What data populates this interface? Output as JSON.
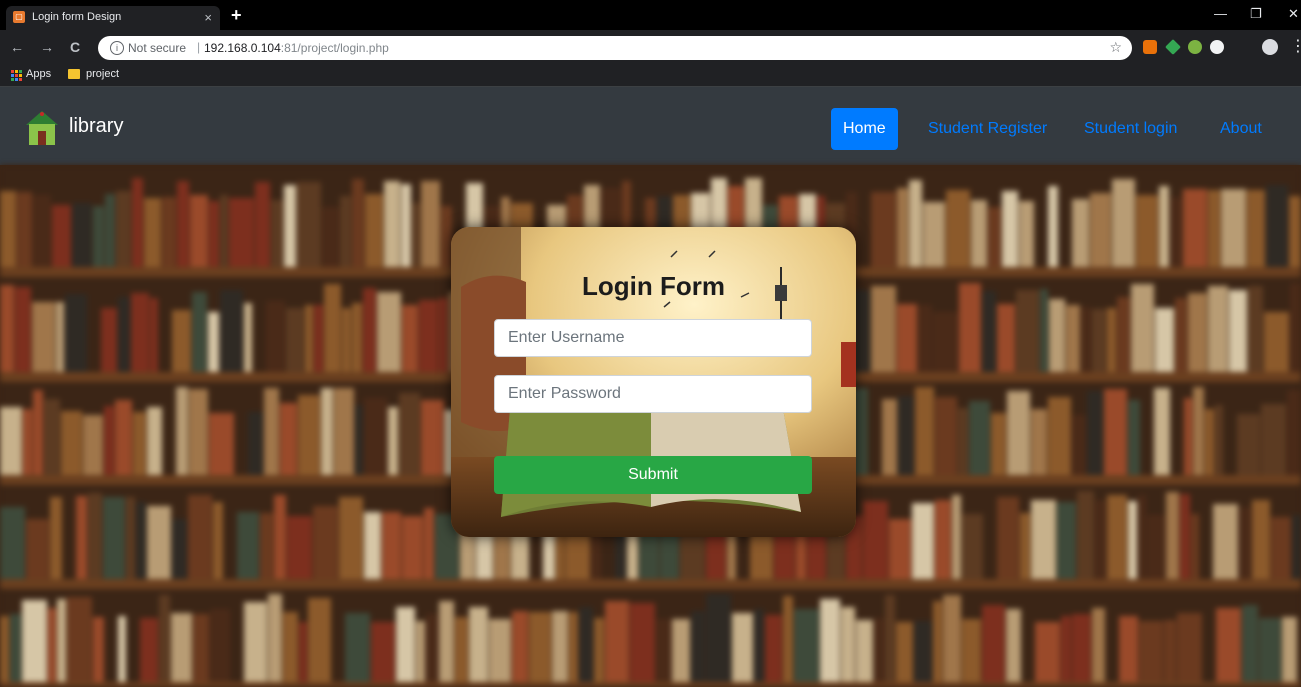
{
  "browser": {
    "tab_title": "Login form Design",
    "tab_close": "×",
    "new_tab": "+",
    "security_label": "Not secure",
    "url_host": "192.168.0.104",
    "url_rest": ":81/project/login.php",
    "bookmarks": [
      {
        "label": "Apps",
        "icon": "apps-grid-icon"
      },
      {
        "label": "project",
        "icon": "folder-icon"
      }
    ]
  },
  "navbar": {
    "brand": "library",
    "links": [
      {
        "label": "Home",
        "active": true
      },
      {
        "label": "Student Register",
        "active": false
      },
      {
        "label": "Student login",
        "active": false
      },
      {
        "label": "About",
        "active": false
      }
    ],
    "colors": {
      "background": "#343a40",
      "link": "#007bff",
      "active_bg": "#007bff"
    }
  },
  "login_form": {
    "title": "Login Form",
    "username_placeholder": "Enter Username",
    "password_placeholder": "Enter Password",
    "submit_label": "Submit",
    "submit_color": "#28a745"
  }
}
